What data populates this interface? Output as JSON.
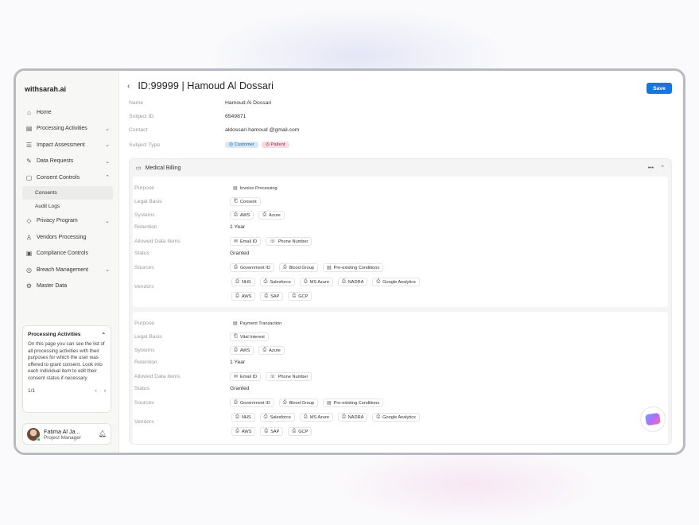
{
  "brand": "withsarah.ai",
  "nav": {
    "home": "Home",
    "processing_activities": "Processing Activities",
    "impact_assessment": "Impact Assessment",
    "data_requests": "Data Requests",
    "consent_controls": "Consent Controls",
    "consents": "Consents",
    "audit_logs": "Audit Logs",
    "privacy_program": "Privacy Program",
    "vendors_processing": "Vendors Processing",
    "compliance_controls": "Compliance Controls",
    "breach_management": "Breach Management",
    "master_data": "Master Data"
  },
  "help": {
    "title": "Processing Activities",
    "text": "On this page you can see the list of all processing activities with their purposes for which the user was offered to grant consent. Look into each individual item to edit their consent status if necessary",
    "pager": "1/1"
  },
  "user": {
    "name": "Fatima Al Ja...",
    "role": "Project Manager"
  },
  "header": {
    "title": "ID:99999 | Hamoud Al Dossari",
    "save": "Save"
  },
  "subject": {
    "name_label": "Name",
    "name": "Hamoud Al Dossari",
    "id_label": "Subject ID",
    "id": "6549871",
    "contact_label": "Contact",
    "contact": "aldossari.hamoud @gmail.com",
    "type_label": "Subject Type",
    "types": [
      "Customer",
      "Patient"
    ]
  },
  "section": {
    "title": "Medical Billing"
  },
  "labels": {
    "purpose": "Purpose",
    "legal_basis": "Legal Basis",
    "systems": "Systems",
    "retention": "Retention",
    "allowed": "Allowed Data Items",
    "status": "Status",
    "sources": "Sources",
    "vendors": "Vendors"
  },
  "cards": [
    {
      "purpose": "Invoice Processing",
      "legal_basis": "Consent",
      "systems": [
        "AWS",
        "Azure"
      ],
      "retention": "1 Year",
      "allowed": [
        "Email ID",
        "Phone Number"
      ],
      "status": "Granted",
      "sources": [
        "Government ID",
        "Blood Group",
        "Pre-existing Conditions"
      ],
      "vendors_row1": [
        "NHS",
        "Salesforce",
        "MS Azure",
        "NADRA",
        "Google Analytics"
      ],
      "vendors_row2": [
        "AWS",
        "SAP",
        "GCP"
      ]
    },
    {
      "purpose": "Payment Transaction",
      "legal_basis": "Vital Interest",
      "systems": [
        "AWS",
        "Azure"
      ],
      "retention": "1 Year",
      "allowed": [
        "Email ID",
        "Phone Number"
      ],
      "status": "Granted",
      "sources": [
        "Government ID",
        "Blood Group",
        "Pre-existing Conditions"
      ],
      "vendors_row1": [
        "NHS",
        "Salesforce",
        "MS Azure",
        "NADRA",
        "Google Analytics"
      ],
      "vendors_row2": [
        "AWS",
        "SAP",
        "GCP"
      ]
    }
  ],
  "colors": {
    "accent": "#1676d9",
    "customer": "#d6e8fb",
    "patient": "#fbdbe3"
  }
}
